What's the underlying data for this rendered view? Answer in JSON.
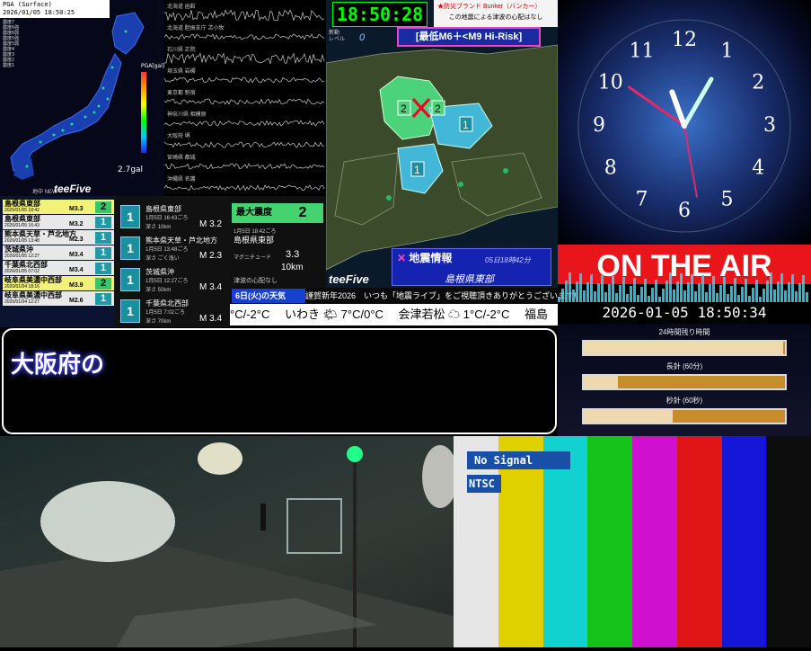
{
  "pga": {
    "title": "PGA (Surface)",
    "timestamp": "2026/01/05 18:50:25",
    "unit": "PGA[gal]",
    "caption": "2.7gal",
    "scale_labels": [
      "震度7",
      "震度6強",
      "震度6弱",
      "震度5強",
      "震度5弱",
      "震度4",
      "震度3",
      "震度2",
      "震度1"
    ]
  },
  "waveforms": [
    {
      "label": "北海道 函館"
    },
    {
      "label": "北海道 胆振支庁 苫小牧"
    },
    {
      "label": "石川県 正院"
    },
    {
      "label": "埼玉県 岩槻"
    },
    {
      "label": "東京都 新宿"
    },
    {
      "label": "神奈川県 相模原"
    },
    {
      "label": "大阪府 堺"
    },
    {
      "label": "宮崎県 都城"
    },
    {
      "label": "沖縄県 名護"
    }
  ],
  "quake_list": {
    "brand": "teeFive",
    "subtitle": "地中 NEW",
    "items": [
      {
        "name": "島根県東部",
        "date": "2026/01/05 18:42",
        "mag": "M3.3",
        "int": "2"
      },
      {
        "name": "島根県東部",
        "date": "2026/01/05 16:43",
        "mag": "M3.2",
        "int": "1"
      },
      {
        "name": "熊本県天草・芦北地方",
        "date": "2026/01/05 13:48",
        "mag": "M2.3",
        "int": "1"
      },
      {
        "name": "茨城県沖",
        "date": "2026/01/05 12:27",
        "mag": "M3.4",
        "int": "1"
      },
      {
        "name": "千葉県北西部",
        "date": "2026/01/05 07:02",
        "mag": "M3.4",
        "int": "1"
      },
      {
        "name": "岐阜県美濃中西部",
        "date": "2026/01/04 18:16",
        "mag": "M3.9",
        "int": "2"
      },
      {
        "name": "岐阜県美濃中西部",
        "date": "2026/01/04 12:27",
        "mag": "M2.6",
        "int": "1"
      }
    ]
  },
  "detail_list": [
    {
      "int": "1",
      "name": "島根県東部",
      "time": "1月5日 16:43ごろ",
      "depth": "深さ 10km",
      "mag": "M 3.2"
    },
    {
      "int": "1",
      "name": "熊本県天草・芦北地方",
      "time": "1月5日 13:48ごろ",
      "depth": "深さ ごく浅い",
      "mag": "M 2.3"
    },
    {
      "int": "1",
      "name": "茨城県沖",
      "time": "1月5日 12:27ごろ",
      "depth": "深さ 50km",
      "mag": "M 3.4"
    },
    {
      "int": "1",
      "name": "千葉県北西部",
      "time": "1月5日 7:02ごろ",
      "depth": "深さ 70km",
      "mag": "M 3.4"
    }
  ],
  "max_panel": {
    "heading": "最大震度",
    "value": "2",
    "time": "1月5日 18:42ごろ",
    "area": "島根県東部",
    "mag_label": "マグニチュード",
    "mag_value": "3.3",
    "depth_value": "10km",
    "tsunami": "津波の心配なし"
  },
  "map_panel": {
    "clock": "18:50:28",
    "level_label": "新動\nレベル",
    "level_value": "0",
    "risk": "[最低M6＋<M9 Hi-Risk]",
    "ticker_title": "★防災ブランド Bunker（バンカー）",
    "ticker_text": "この地震による津波の心配はなし",
    "info_title": "地震情報",
    "info_date": "05日18時42分",
    "info_area": "島根県東部",
    "brand": "teeFive",
    "intensity_markers": [
      "2",
      "2",
      "1",
      "1"
    ]
  },
  "banner": {
    "weather_day": "6日(火)の天気",
    "greeting": "謹賀新年2026　いつも「地震ライブ」をご視聴頂きありがとうございます!",
    "forecast": "°C/-2°C　 いわき 🌤 7°C/0°C　 会津若松 ☁ 1°C/-2°C　 福島"
  },
  "right_panel": {
    "on_air": "ON THE AIR",
    "datetime": "2026-01-05 18:50:34",
    "remain_title": "24時間残り時間",
    "bars": [
      {
        "label": "",
        "fraction": 0.99
      },
      {
        "label": "長針 (60分)",
        "fraction": 0.17
      },
      {
        "label": "秒針 (60秒)",
        "fraction": 0.44
      }
    ],
    "clock_numbers": [
      "12",
      "1",
      "2",
      "3",
      "4",
      "5",
      "6",
      "7",
      "8",
      "9",
      "10",
      "11"
    ]
  },
  "message": {
    "text": "大阪府の"
  },
  "color_bars": {
    "no_signal": "No Signal",
    "format": "NTSC",
    "colors": [
      "#e6e6e6",
      "#e0d000",
      "#12d2d0",
      "#15c21a",
      "#d010d0",
      "#e01616",
      "#1616d8",
      "#0d0d0d"
    ]
  }
}
